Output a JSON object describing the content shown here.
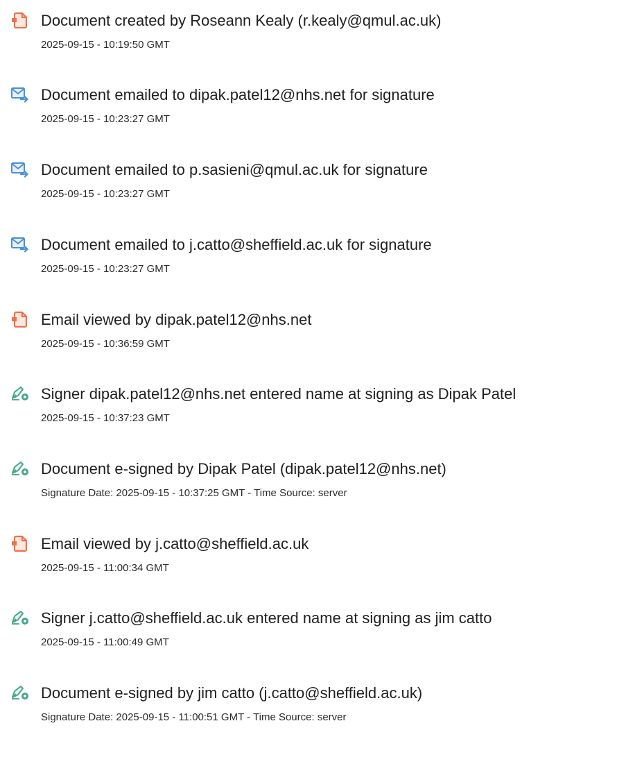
{
  "events": [
    {
      "icon": "document-icon",
      "title": "Document created by Roseann Kealy (r.kealy@qmul.ac.uk)",
      "time": "2025-09-15 - 10:19:50 GMT"
    },
    {
      "icon": "email-sent-icon",
      "title": "Document emailed to dipak.patel12@nhs.net for signature",
      "time": "2025-09-15 - 10:23:27 GMT"
    },
    {
      "icon": "email-sent-icon",
      "title": "Document emailed to p.sasieni@qmul.ac.uk for signature",
      "time": "2025-09-15 - 10:23:27 GMT"
    },
    {
      "icon": "email-sent-icon",
      "title": "Document emailed to j.catto@sheffield.ac.uk for signature",
      "time": "2025-09-15 - 10:23:27 GMT"
    },
    {
      "icon": "document-icon",
      "title": "Email viewed by dipak.patel12@nhs.net",
      "time": "2025-09-15 - 10:36:59 GMT"
    },
    {
      "icon": "pen-sign-icon",
      "title": "Signer dipak.patel12@nhs.net entered name at signing as Dipak Patel",
      "time": "2025-09-15 - 10:37:23 GMT"
    },
    {
      "icon": "pen-sign-icon",
      "title": "Document e-signed by Dipak Patel (dipak.patel12@nhs.net)",
      "time": "Signature Date: 2025-09-15 - 10:37:25 GMT - Time Source: server"
    },
    {
      "icon": "document-icon",
      "title": "Email viewed by j.catto@sheffield.ac.uk",
      "time": "2025-09-15 - 11:00:34 GMT"
    },
    {
      "icon": "pen-sign-icon",
      "title": "Signer j.catto@sheffield.ac.uk entered name at signing as jim catto",
      "time": "2025-09-15 - 11:00:49 GMT"
    },
    {
      "icon": "pen-sign-icon",
      "title": "Document e-signed by jim catto (j.catto@sheffield.ac.uk)",
      "time": "Signature Date: 2025-09-15 - 11:00:51 GMT - Time Source: server"
    }
  ],
  "colors": {
    "document_icon": "#e8734a",
    "email_icon": "#4a90d9",
    "pen_icon": "#43a58a"
  }
}
